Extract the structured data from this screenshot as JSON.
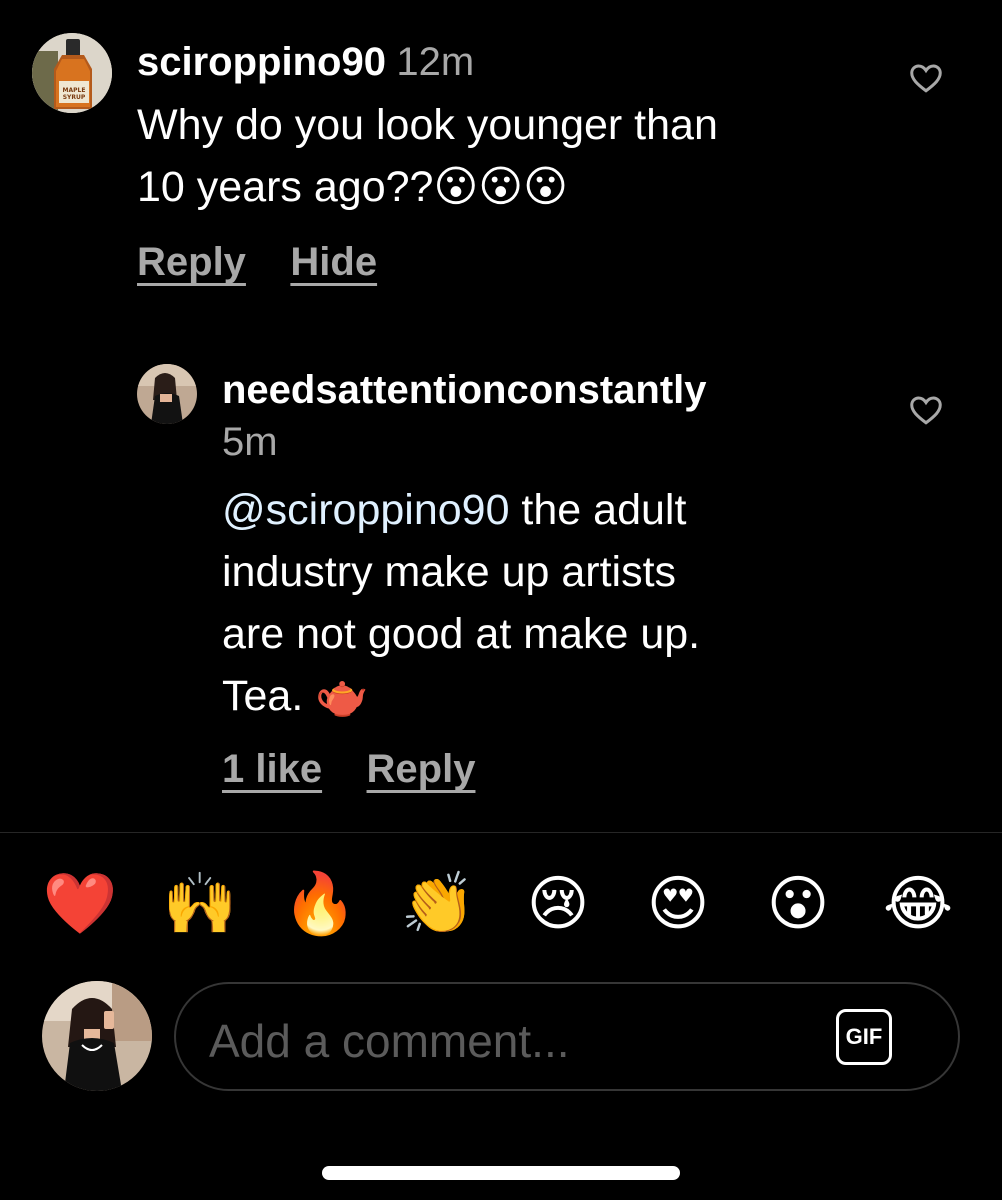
{
  "comment": {
    "username": "sciroppino90",
    "time": "12m",
    "text_line1": "Why do you look younger than",
    "text_line2": "10 years ago??😮😮😮",
    "reply_label": "Reply",
    "hide_label": "Hide",
    "avatar_lines": [
      "MAPLE",
      "SYRUP"
    ]
  },
  "reply": {
    "username": "needsattentionconstantly",
    "time": "5m",
    "mention": "@sciroppino90",
    "text_line1_rest": " the adult",
    "text_line2": "industry make up artists",
    "text_line3": "are not good at make up.",
    "text_line4": "Tea. 🫖",
    "likes_label": "1 like",
    "reply_label": "Reply"
  },
  "reactions": [
    "❤️",
    "🙌",
    "🔥",
    "👏",
    "😢",
    "😍",
    "😮",
    "😂"
  ],
  "composer": {
    "placeholder": "Add a comment...",
    "gif_label": "GIF"
  },
  "colors": {
    "background": "#000000",
    "secondary_text": "#a8a8a8",
    "mention": "#e0f1ff",
    "placeholder": "#5b5b5b"
  }
}
